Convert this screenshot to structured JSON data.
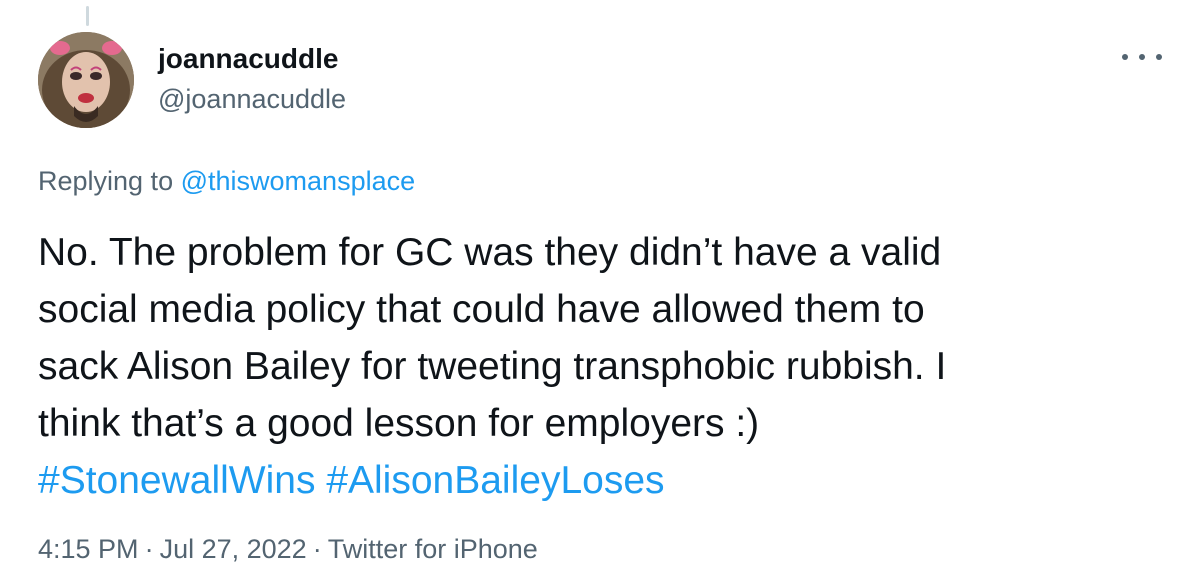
{
  "author": {
    "display_name": "joannacuddle",
    "handle": "@joannacuddle"
  },
  "replying": {
    "prefix": "Replying to",
    "mention": "@thiswomansplace"
  },
  "tweet": {
    "lines": [
      "No. The problem for GC was they didn’t have a valid",
      "social media policy that could have allowed them to",
      "sack Alison Bailey for tweeting transphobic rubbish. I",
      "think that’s a good lesson for employers :)"
    ],
    "hashtags": [
      "#StonewallWins",
      "#AlisonBaileyLoses"
    ]
  },
  "meta": {
    "time": "4:15 PM",
    "date": "Jul 27, 2022",
    "source": "Twitter for iPhone",
    "separator": "·"
  },
  "icons": {
    "more": "more-horizontal-icon",
    "avatar": "profile-photo"
  },
  "colors": {
    "text": "#0f1419",
    "secondary": "#536471",
    "link": "#1d9bf0"
  }
}
